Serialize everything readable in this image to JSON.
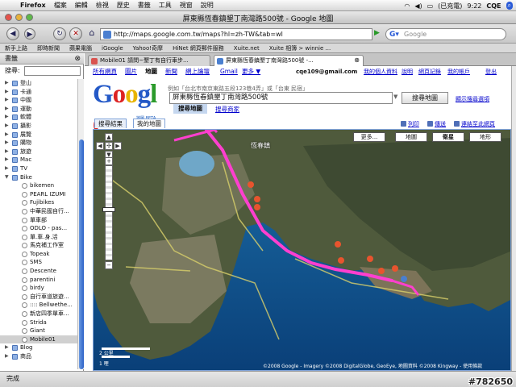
{
  "menubar": {
    "app": "Firefox",
    "items": [
      "檔案",
      "編輯",
      "檢視",
      "歷史",
      "書籤",
      "工具",
      "視窗",
      "說明"
    ],
    "battery": "(已充電)",
    "time": "9:22",
    "user": "CQE"
  },
  "window": {
    "title": "屏東縣恆春鎮墾丁南灣路500號 - Google 地圖"
  },
  "navbar": {
    "url": "http://maps.google.com.tw/maps?hl=zh-TW&tab=wl",
    "search_placeholder": "Google"
  },
  "bookmarks": [
    "新手上路",
    "即時新聞",
    "蘋果電腦",
    "iGoogle",
    "Yahoo!奇摩",
    "HiNet 網頁郵件服務",
    "Xuite.net",
    "Xuite 相簿 > winnie ..."
  ],
  "sidebar": {
    "title": "書籤",
    "search_label": "搜尋:",
    "items": [
      {
        "label": "登山",
        "type": "folder",
        "level": 1
      },
      {
        "label": "卡通",
        "type": "folder",
        "level": 1
      },
      {
        "label": "中國",
        "type": "folder",
        "level": 1
      },
      {
        "label": "運動",
        "type": "folder",
        "level": 1
      },
      {
        "label": "軟體",
        "type": "folder",
        "level": 1
      },
      {
        "label": "攝影",
        "type": "folder",
        "level": 1
      },
      {
        "label": "展覽",
        "type": "folder",
        "level": 1
      },
      {
        "label": "購物",
        "type": "folder",
        "level": 1
      },
      {
        "label": "旅遊",
        "type": "folder",
        "level": 1
      },
      {
        "label": "Mac",
        "type": "folder",
        "level": 1
      },
      {
        "label": "TV",
        "type": "folder",
        "level": 1
      },
      {
        "label": "Bike",
        "type": "folder",
        "level": 1,
        "open": true
      },
      {
        "label": "bikemen",
        "type": "page",
        "level": 2
      },
      {
        "label": "PEARL IZUMI",
        "type": "page",
        "level": 2
      },
      {
        "label": "Fujibikes",
        "type": "page",
        "level": 2
      },
      {
        "label": "中華民國自行...",
        "type": "page",
        "level": 2
      },
      {
        "label": "單車部",
        "type": "page",
        "level": 2
      },
      {
        "label": "ODLO - pas...",
        "type": "page",
        "level": 2
      },
      {
        "label": "單.車.身.活",
        "type": "page",
        "level": 2
      },
      {
        "label": "馬克補工作室",
        "type": "page",
        "level": 2
      },
      {
        "label": "Topeak",
        "type": "page",
        "level": 2
      },
      {
        "label": "SMS",
        "type": "page",
        "level": 2
      },
      {
        "label": "Descente",
        "type": "page",
        "level": 2
      },
      {
        "label": "parentini",
        "type": "page",
        "level": 2
      },
      {
        "label": "birdy",
        "type": "page",
        "level": 2
      },
      {
        "label": "自行車道旅遊...",
        "type": "page",
        "level": 2
      },
      {
        "label": ":::: Bellwethe...",
        "type": "page",
        "level": 2
      },
      {
        "label": "新店四季單車...",
        "type": "page",
        "level": 2
      },
      {
        "label": "Strida",
        "type": "page",
        "level": 2
      },
      {
        "label": "Giant",
        "type": "page",
        "level": 2
      },
      {
        "label": "Mobile01",
        "type": "page",
        "level": 2,
        "selected": true
      },
      {
        "label": "Blog",
        "type": "folder",
        "level": 1
      },
      {
        "label": "商品",
        "type": "folder",
        "level": 1
      }
    ]
  },
  "tabs": [
    {
      "label": "Mobile01 請問~墾丁有自行車步...",
      "active": false
    },
    {
      "label": "屏東縣恆春鎮墾丁南灣路500號 -...",
      "active": true
    }
  ],
  "google": {
    "nav": [
      "所有網頁",
      "圖片",
      "地圖",
      "新聞",
      "網上論壇",
      "Gmail",
      "更多 ▼"
    ],
    "user_email": "cqe109@gmail.com",
    "user_links": [
      "我的個人資料",
      "說明",
      "網頁記錄",
      "我的帳戶",
      "登出"
    ],
    "example": "例如「台北市南京東路五段123巷4弄」或「台東 民宿」",
    "query": "屏東縣恆春鎮墾丁南灣路500號",
    "search_button": "搜尋地圖",
    "options_link": "顯示搜尋選項",
    "subtabs": [
      "搜尋地圖",
      "搜尋商家"
    ],
    "logo_sub": "地圖 BETA",
    "left_tabs": [
      "搜尋結果",
      "我的地圖"
    ],
    "right_links": [
      "列印",
      "傳送",
      "連結至此網頁"
    ]
  },
  "map": {
    "city_label": "恆春鎮",
    "types": [
      "更多...",
      "地圖",
      "衛星",
      "地形"
    ],
    "scale_km": "2 公里",
    "scale_mi": "1 哩",
    "copyright": "©2008 Google - Imagery ©2008 DigitalGlobe, GeoEye, 地圖資料 ©2008 Kingway - 使用條款",
    "markers": [
      "B",
      "A",
      "G",
      "J",
      "H",
      "K",
      "D",
      "C",
      "E"
    ]
  },
  "status": {
    "text": "完成",
    "watermark": "#782650"
  }
}
